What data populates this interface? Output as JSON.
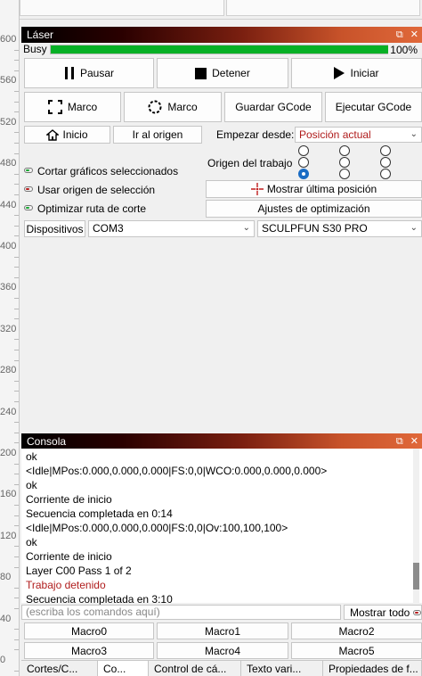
{
  "ruler": {
    "labels": [
      "600",
      "560",
      "520",
      "480",
      "440",
      "400",
      "360",
      "320",
      "280",
      "240",
      "200",
      "160",
      "120",
      "80",
      "40",
      "0"
    ]
  },
  "laser_panel": {
    "title": "Láser",
    "status": "Busy",
    "progress_percent": 100,
    "progress_text": "100%",
    "buttons": {
      "pause": "Pausar",
      "stop": "Detener",
      "start": "Iniciar",
      "frame1": "Marco",
      "frame2": "Marco",
      "save_gcode": "Guardar GCode",
      "run_gcode": "Ejecutar GCode",
      "home": "Inicio",
      "goto_origin": "Ir al origen",
      "show_last_position": "Mostrar última posición",
      "optimization_settings": "Ajustes de optimización",
      "devices": "Dispositivos"
    },
    "start_from_label": "Empezar desde:",
    "start_from_value": "Posición actual",
    "job_origin_label": "Origen del trabajo",
    "options": {
      "cut_selected": "Cortar gráficos seleccionados",
      "use_selection_origin": "Usar origen de selección",
      "optimize_cut_path": "Optimizar ruta de corte"
    },
    "port": "COM3",
    "device": "SCULPFUN S30 PRO",
    "colors": {
      "progress": "#06b025",
      "toggle_on": "#18a832",
      "toggle_off": "#b81c1c",
      "radio_selected": "#1a6cc4"
    }
  },
  "console_panel": {
    "title": "Consola",
    "lines": [
      {
        "text": "ok",
        "error": false
      },
      {
        "text": "<Idle|MPos:0.000,0.000,0.000|FS:0,0|WCO:0.000,0.000,0.000>",
        "error": false
      },
      {
        "text": "ok",
        "error": false
      },
      {
        "text": "Corriente de inicio",
        "error": false
      },
      {
        "text": "Secuencia completada en 0:14",
        "error": false
      },
      {
        "text": "<Idle|MPos:0.000,0.000,0.000|FS:0,0|Ov:100,100,100>",
        "error": false
      },
      {
        "text": "ok",
        "error": false
      },
      {
        "text": "Corriente de inicio",
        "error": false
      },
      {
        "text": "Layer C00 Pass 1 of 2",
        "error": false
      },
      {
        "text": "Trabajo detenido",
        "error": true
      },
      {
        "text": "Secuencia completada en 3:10",
        "error": false
      }
    ],
    "command_placeholder": "(escriba los comandos aquí)",
    "show_all": "Mostrar todo",
    "macros": [
      "Macro0",
      "Macro1",
      "Macro2",
      "Macro3",
      "Macro4",
      "Macro5"
    ],
    "colors": {
      "error_text": "#b01c1c"
    }
  },
  "tabs": [
    "Cortes/C...",
    "Co...",
    "Control de cá...",
    "Texto vari...",
    "Propiedades de f..."
  ]
}
